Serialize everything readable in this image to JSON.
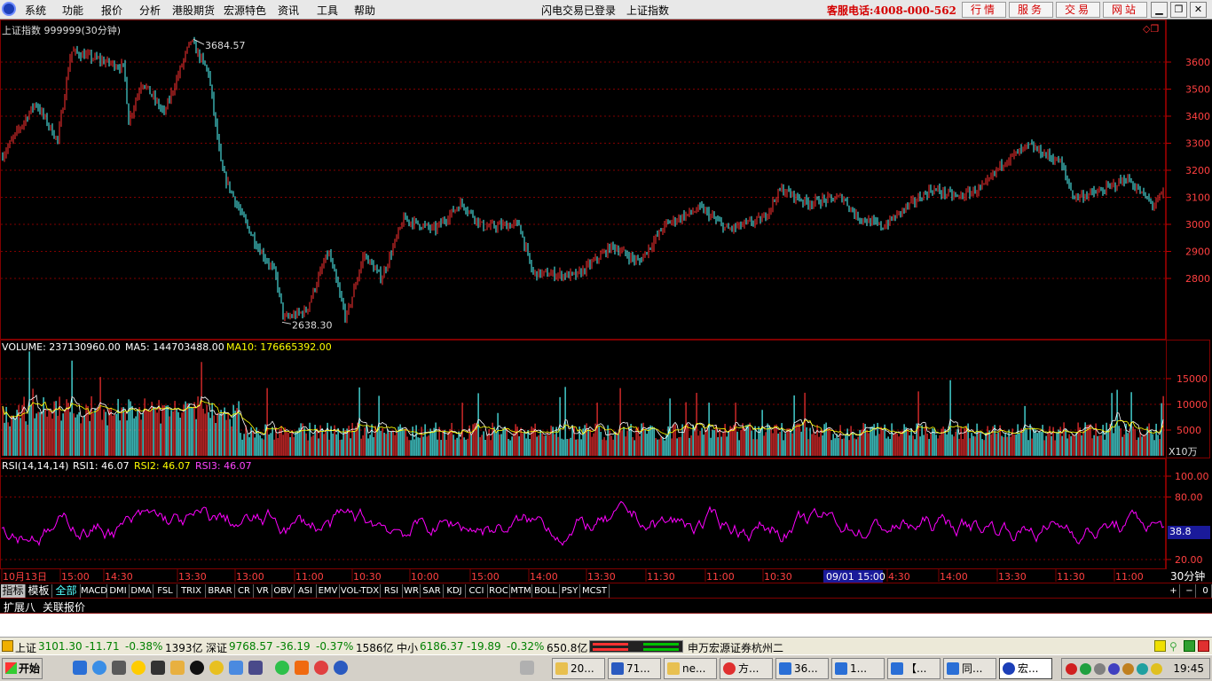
{
  "menubar": {
    "items": [
      "系统",
      "功能",
      "报价",
      "分析",
      "港股期货",
      "宏源特色",
      "资讯",
      "工具",
      "帮助"
    ],
    "status_login": "闪电交易已登录",
    "index_name": "上证指数",
    "hotline": "客服电话:4008-000-562",
    "quick_buttons": [
      "行情",
      "服务",
      "交易",
      "网站"
    ]
  },
  "chart": {
    "title": "上证指数 999999(30分钟)",
    "high_label": "3684.57",
    "low_label": "2638.30",
    "price_ticks": [
      "3600",
      "3500",
      "3400",
      "3300",
      "3200",
      "3100",
      "3000",
      "2900",
      "2800"
    ],
    "volume": {
      "label": "VOLUME: 237130960.00",
      "ma5": "MA5: 144703488.00",
      "ma10": "MA10: 176665392.00",
      "ticks": [
        "15000",
        "10000",
        "5000"
      ],
      "unit": "X10万"
    },
    "rsi": {
      "label": "RSI(14,14,14)",
      "rsi1": "RSI1: 46.07",
      "rsi2": "RSI2: 46.07",
      "rsi3": "RSI3: 46.07",
      "ticks": [
        "100.00",
        "80.00",
        "20.00"
      ],
      "current": "38.8"
    },
    "time_labels": [
      "10月13日",
      "15:00",
      "14:30",
      "13:30",
      "13:00",
      "11:00",
      "10:30",
      "10:00",
      "15:00",
      "14:00",
      "13:30",
      "11:30",
      "11:00",
      "10:30",
      "09/01 15:00",
      "4:30",
      "14:00",
      "13:30",
      "11:30",
      "11:00"
    ],
    "period": "30分钟",
    "colors": {
      "up": "#ff3232",
      "down": "#54ffff",
      "rsi1": "#ffffff",
      "rsi2": "#ffff00",
      "rsi3": "#ff00ff",
      "ma5": "#ffffff",
      "ma10": "#ffff00",
      "grid": "#800000"
    }
  },
  "indicator_tabs": [
    "指标",
    "模板",
    "全部",
    "MACD",
    "DMI",
    "DMA",
    "FSL",
    "TRIX",
    "BRAR",
    "CR",
    "VR",
    "OBV",
    "ASI",
    "EMV",
    "VOL-TDX",
    "RSI",
    "WR",
    "SAR",
    "KDJ",
    "CCI",
    "ROC",
    "MTM",
    "BOLL",
    "PSY",
    "MCST"
  ],
  "indicator_controls": [
    "+",
    "−",
    "0"
  ],
  "ext_tabs": [
    "扩展八",
    "关联报价"
  ],
  "statusbar": {
    "sh_name": "上证",
    "sh_value": "3101.30",
    "sh_change": "-11.71",
    "sh_pct": "-0.38%",
    "sh_amount": "1393亿",
    "sz_name": "深证",
    "sz_value": "9768.57",
    "sz_change": "-36.19",
    "sz_pct": "-0.37%",
    "sz_amount": "1586亿",
    "zx_name": "中小",
    "zx_value": "6186.37",
    "zx_change": "-19.89",
    "zx_pct": "-0.32%",
    "zx_amount": "650.8亿",
    "broker": "申万宏源证券杭州二"
  },
  "taskbar": {
    "start": "开始",
    "tasks": [
      "20...",
      "71...",
      "ne...",
      "方...",
      "36...",
      "1...",
      "【...",
      "同...",
      "宏..."
    ],
    "clock": "19:45"
  }
}
